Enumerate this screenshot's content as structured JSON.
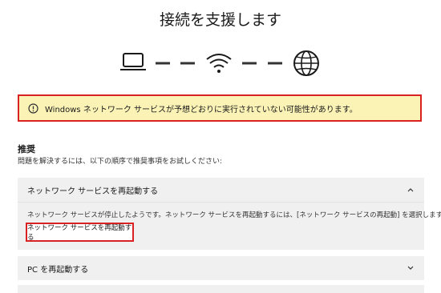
{
  "title": "接続を支援します",
  "warning": {
    "text": "Windows ネットワーク サービスが予想どおりに実行されていない可能性があります。",
    "icon": "info-circle-icon"
  },
  "recommendations": {
    "heading": "推奨",
    "description": "問題を解決するには、以下の順序で推奨事項をお試しください:"
  },
  "panels": [
    {
      "label": "ネットワーク サービスを再起動する",
      "expanded": true,
      "body": "ネットワーク サービスが停止したようです。ネットワーク サービスを再起動するには、[ネットワーク サービスの再起動] を選択します。",
      "button": "ネットワーク サービスを再起動する"
    },
    {
      "label": "PC を再起動する",
      "expanded": false
    }
  ],
  "connection_icons": [
    "laptop-icon",
    "wifi-icon",
    "globe-icon"
  ]
}
